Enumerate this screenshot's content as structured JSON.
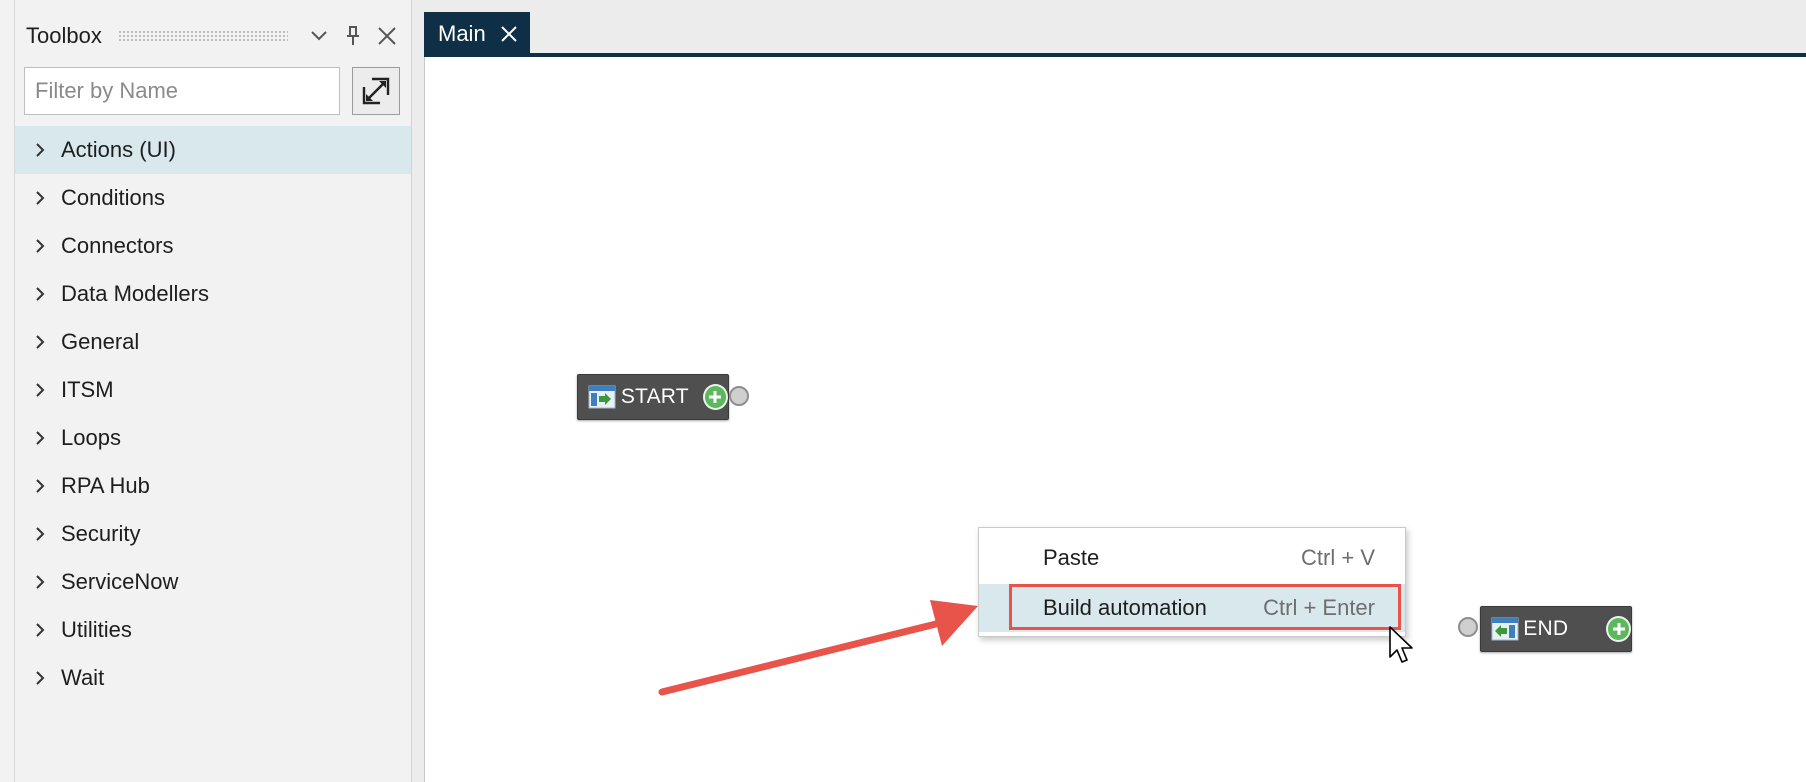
{
  "toolbox": {
    "title": "Toolbox",
    "filter_placeholder": "Filter by Name",
    "categories": [
      {
        "label": "Actions (UI)"
      },
      {
        "label": "Conditions"
      },
      {
        "label": "Connectors"
      },
      {
        "label": "Data Modellers"
      },
      {
        "label": "General"
      },
      {
        "label": "ITSM"
      },
      {
        "label": "Loops"
      },
      {
        "label": "RPA Hub"
      },
      {
        "label": "Security"
      },
      {
        "label": "ServiceNow"
      },
      {
        "label": "Utilities"
      },
      {
        "label": "Wait"
      }
    ],
    "selected_category": "Actions (UI)"
  },
  "tabs": [
    {
      "label": "Main"
    }
  ],
  "canvas": {
    "start_node": {
      "label": "START"
    },
    "end_node": {
      "label": "END"
    }
  },
  "context_menu": {
    "items": [
      {
        "label": "Paste",
        "shortcut": "Ctrl + V"
      },
      {
        "label": "Build automation",
        "shortcut": "Ctrl + Enter"
      }
    ]
  },
  "colors": {
    "tab_active": "#0f2f46",
    "selection": "#d9e8ec",
    "node_bg": "#4f4f4f",
    "plus_green": "#5cb85c",
    "annotation_red": "#e8534a"
  },
  "icons": [
    "chevron-down-icon",
    "pin-icon",
    "close-icon",
    "expand-icon",
    "chevron-right-icon",
    "start-icon",
    "end-icon",
    "add-icon",
    "cursor-icon",
    "arrow-annotation"
  ]
}
